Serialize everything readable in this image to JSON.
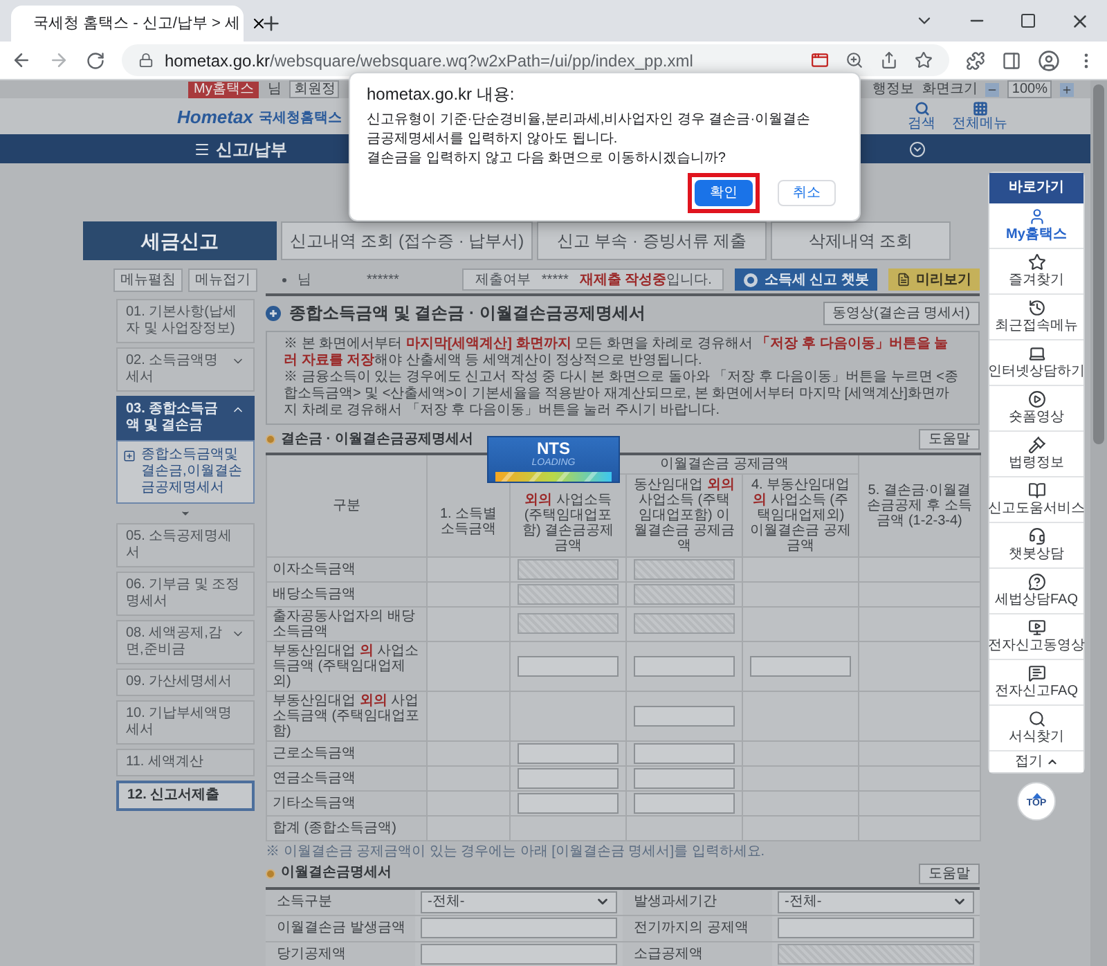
{
  "browser": {
    "tab_title": "국세청 홈택스 - 신고/납부 > 세",
    "url_host": "hometax.go.kr",
    "url_path": "/websquare/websquare.wq?w2xPath=/ui/pp/index_pp.xml"
  },
  "utility_bar": {
    "my_button": "My홈택스",
    "user_suffix": "님",
    "member_button": "회원정",
    "info_link": "행정보",
    "screen_size_label": "화면크기",
    "zoom_value": "100%"
  },
  "header": {
    "logo_main": "Hometax",
    "logo_sub": "국세청홈택스",
    "search": "검색",
    "all_menu": "전체메뉴"
  },
  "nav": {
    "title": "신고/납부"
  },
  "tabs": [
    {
      "label": "세금신고",
      "selected": true
    },
    {
      "label": "신고내역 조회 (접수증 · 납부서)",
      "selected": false
    },
    {
      "label": "신고 부속 · 증빙서류 제출",
      "selected": false
    },
    {
      "label": "삭제내역 조회",
      "selected": false
    }
  ],
  "side_menu": {
    "buttons": [
      "메뉴펼침",
      "메뉴접기"
    ],
    "items": [
      {
        "label": "01. 기본사항(납세자 및 사업장정보)",
        "kind": "page",
        "selected": false,
        "focused": false
      },
      {
        "label": "02. 소득금액명세서",
        "kind": "group",
        "selected": false,
        "expanded": false,
        "focused": false
      },
      {
        "label": "03. 종합소득금액 및 결손금",
        "kind": "group",
        "selected": true,
        "expanded": true,
        "focused": false,
        "children": [
          {
            "label": "종합소득금액및결손금,이월결손금공제명세서"
          }
        ]
      },
      {
        "label": "05. 소득공제명세서",
        "kind": "page",
        "selected": false,
        "focused": false
      },
      {
        "label": "06. 기부금 및 조정명세서",
        "kind": "page",
        "selected": false,
        "focused": false
      },
      {
        "label": "08. 세액공제,감면,준비금",
        "kind": "group",
        "selected": false,
        "expanded": false,
        "focused": false
      },
      {
        "label": "09. 가산세명세서",
        "kind": "page",
        "selected": false,
        "focused": false
      },
      {
        "label": "10. 기납부세액명세서",
        "kind": "page",
        "selected": false,
        "focused": false
      },
      {
        "label": "11. 세액계산",
        "kind": "page",
        "selected": false,
        "focused": false
      },
      {
        "label": "12. 신고서제출",
        "kind": "page",
        "selected": false,
        "focused": true
      }
    ]
  },
  "status_bar": {
    "name_suffix": "님",
    "masked_id": "******",
    "status_label": "제출여부",
    "status_mask": "*****",
    "status_text": [
      {
        "text": "재제출 작성중",
        "emphasis": true
      },
      {
        "text": "입니다.",
        "emphasis": false
      }
    ],
    "chatbot_button": "소득세 신고 챗봇",
    "preview_button": "미리보기"
  },
  "page_title": "종합소득금액 및 결손금 · 이월결손금공제명세서",
  "video_button": "동영상(결손금 명세서)",
  "notice": [
    [
      {
        "text": "※ 본 화면에서부터 ",
        "emphasis": false
      },
      {
        "text": "마지막[세액계산] 화면까지",
        "emphasis": true
      },
      {
        "text": " 모든 화면을 차례로 경유해서 ",
        "emphasis": false
      },
      {
        "text": "「저장 후 다음이동」버튼을 눌러 자료를 저장",
        "emphasis": true
      },
      {
        "text": "해야 산출세액 등 세액계산이 정상적으로 반영됩니다.",
        "emphasis": false
      }
    ],
    [
      {
        "text": "※ 금융소득이 있는 경우에도 신고서 작성 중 다시 본 화면으로 돌아와 「저장 후 다음이동」버튼을 누르면 <종합소득금액> 및 <산출세액>이 기본세율을 적용받아 재계산되므로, 본 화면에서부터 마지막 [세액계산]화면까지 차례로 경유해서 「저장 후 다음이동」버튼을 눌러 주시기 바랍니다.",
        "emphasis": false
      }
    ]
  ],
  "loss_section": {
    "title": "결손금 · 이월결손금공제명세서",
    "help_button": "도움말",
    "table": {
      "category_header": "구분",
      "income_header": "1. 소득별 소득금액",
      "group_header": "이월결손금 공제금액",
      "deduction_headers": [
        [
          {
            "text": "외의",
            "emphasis": true
          },
          {
            "text": " 사업소득 (주택임대업포함) 결손금공제금액",
            "emphasis": false
          }
        ],
        [
          {
            "text": "동산임대업 ",
            "emphasis": false
          },
          {
            "text": "외의",
            "emphasis": true
          },
          {
            "text": " 사업소득 (주택임대업포함) 이월결손금 공제금액",
            "emphasis": false
          }
        ],
        [
          {
            "text": "4. 부동산임대업 ",
            "emphasis": false
          },
          {
            "text": "의",
            "emphasis": true
          },
          {
            "text": " 사업소득 (주택임대업제외) 이월결손금 공제금액",
            "emphasis": false
          }
        ]
      ],
      "result_header": "5. 결손금·이월결손금공제 후 소득금액 (1-2-3-4)",
      "rows": [
        {
          "label": [
            {
              "text": "이자소득금액",
              "emphasis": false
            }
          ],
          "cells": [
            {
              "kind": "empty"
            },
            {
              "kind": "disabled"
            },
            {
              "kind": "disabled"
            },
            {
              "kind": "empty"
            },
            {
              "kind": "empty"
            }
          ]
        },
        {
          "label": [
            {
              "text": "배당소득금액",
              "emphasis": false
            }
          ],
          "cells": [
            {
              "kind": "empty"
            },
            {
              "kind": "disabled"
            },
            {
              "kind": "disabled"
            },
            {
              "kind": "empty"
            },
            {
              "kind": "empty"
            }
          ]
        },
        {
          "label": [
            {
              "text": "출자공동사업자의 배당소득금액",
              "emphasis": false
            }
          ],
          "cells": [
            {
              "kind": "empty"
            },
            {
              "kind": "disabled"
            },
            {
              "kind": "disabled"
            },
            {
              "kind": "empty"
            },
            {
              "kind": "empty"
            }
          ]
        },
        {
          "label": [
            {
              "text": "부동산임대업 ",
              "emphasis": false
            },
            {
              "text": "의",
              "emphasis": true
            },
            {
              "text": " 사업소득금액 (주택임대업제외)",
              "emphasis": false
            }
          ],
          "cells": [
            {
              "kind": "empty"
            },
            {
              "kind": "input"
            },
            {
              "kind": "input"
            },
            {
              "kind": "input"
            },
            {
              "kind": "empty"
            }
          ]
        },
        {
          "label": [
            {
              "text": "부동산임대업 ",
              "emphasis": false
            },
            {
              "text": "외의",
              "emphasis": true
            },
            {
              "text": " 사업소득금액 (주택임대업포함)",
              "emphasis": false
            }
          ],
          "cells": [
            {
              "kind": "empty"
            },
            {
              "kind": "empty"
            },
            {
              "kind": "input"
            },
            {
              "kind": "empty"
            },
            {
              "kind": "empty"
            }
          ]
        },
        {
          "label": [
            {
              "text": "근로소득금액",
              "emphasis": false
            }
          ],
          "cells": [
            {
              "kind": "empty"
            },
            {
              "kind": "input"
            },
            {
              "kind": "input"
            },
            {
              "kind": "empty"
            },
            {
              "kind": "empty"
            }
          ]
        },
        {
          "label": [
            {
              "text": "연금소득금액",
              "emphasis": false
            }
          ],
          "cells": [
            {
              "kind": "empty"
            },
            {
              "kind": "input"
            },
            {
              "kind": "input"
            },
            {
              "kind": "empty"
            },
            {
              "kind": "empty"
            }
          ]
        },
        {
          "label": [
            {
              "text": "기타소득금액",
              "emphasis": false
            }
          ],
          "cells": [
            {
              "kind": "empty"
            },
            {
              "kind": "input"
            },
            {
              "kind": "input"
            },
            {
              "kind": "empty"
            },
            {
              "kind": "empty"
            }
          ]
        },
        {
          "label": [
            {
              "text": "합계 (종합소득금액)",
              "emphasis": false
            }
          ],
          "cells": [
            {
              "kind": "empty"
            },
            {
              "kind": "empty"
            },
            {
              "kind": "empty"
            },
            {
              "kind": "empty"
            },
            {
              "kind": "empty"
            }
          ]
        }
      ]
    },
    "note": "※ 이월결손금 공제금액이 있는 경우에는 아래 [이월결손금 명세서]를 입력하세요."
  },
  "carryover_section": {
    "title": "이월결손금명세서",
    "help_button": "도움말",
    "rows": [
      [
        {
          "label": "소득구분",
          "kind": "select",
          "value": "-전체-"
        },
        {
          "label": "발생과세기간",
          "kind": "select",
          "value": "-전체-"
        }
      ],
      [
        {
          "label": "이월결손금 발생금액",
          "kind": "input"
        },
        {
          "label": "전기까지의 공제액",
          "kind": "input"
        }
      ],
      [
        {
          "label": "당기공제액",
          "kind": "input"
        },
        {
          "label": "소급공제액",
          "kind": "disabled"
        }
      ]
    ]
  },
  "quick_links": {
    "title": "바로가기",
    "items": [
      {
        "label": "My홈택스",
        "selected": true
      },
      {
        "label": "즐겨찾기",
        "selected": false
      },
      {
        "label": "최근접속메뉴",
        "selected": false
      },
      {
        "label": "인터넷상담하기",
        "selected": false
      },
      {
        "label": "숏폼영상",
        "selected": false
      },
      {
        "label": "법령정보",
        "selected": false
      },
      {
        "label": "신고도움서비스",
        "selected": false
      },
      {
        "label": "챗봇상담",
        "selected": false
      },
      {
        "label": "세법상담FAQ",
        "selected": false
      },
      {
        "label": "전자신고동영상",
        "selected": false
      },
      {
        "label": "전자신고FAQ",
        "selected": false
      },
      {
        "label": "서식찾기",
        "selected": false
      }
    ],
    "collapse": "접기",
    "top": "TOP"
  },
  "loading": {
    "title": "NTS",
    "subtitle": "LOADING"
  },
  "dialog": {
    "title": "hometax.go.kr 내용:",
    "message": [
      "신고유형이 기준·단순경비율,분리과세,비사업자인 경우 결손금·이월결손",
      "금공제명세서를 입력하지 않아도 됩니다.",
      "결손금을 입력하지 않고 다음 화면으로 이동하시겠습니까?"
    ],
    "buttons": [
      {
        "label": "확인",
        "kind": "primary",
        "highlighted": true
      },
      {
        "label": "취소",
        "kind": "secondary",
        "highlighted": false
      }
    ]
  }
}
